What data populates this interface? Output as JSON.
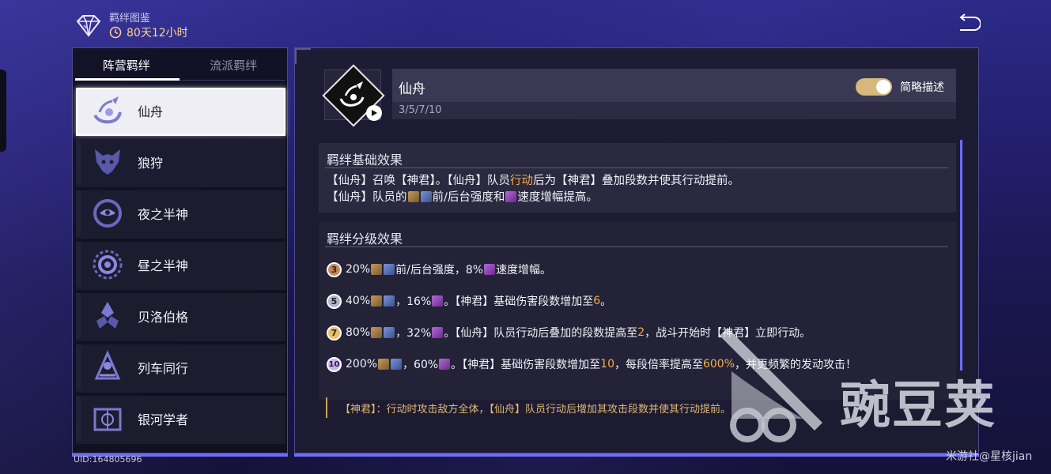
{
  "header": {
    "title": "羁绊图鉴",
    "timer": "80天12小时"
  },
  "tabs": [
    {
      "label": "阵营羁绊",
      "active": true
    },
    {
      "label": "流派羁绊",
      "active": false
    }
  ],
  "factions": [
    {
      "name": "仙舟",
      "icon": "xianzhou-icon",
      "selected": true
    },
    {
      "name": "狼狩",
      "icon": "wolf-icon",
      "selected": false
    },
    {
      "name": "夜之半神",
      "icon": "moon-icon",
      "selected": false
    },
    {
      "name": "昼之半神",
      "icon": "sun-icon",
      "selected": false
    },
    {
      "name": "贝洛伯格",
      "icon": "belobog-icon",
      "selected": false
    },
    {
      "name": "列车同行",
      "icon": "train-icon",
      "selected": false
    },
    {
      "name": "银河学者",
      "icon": "scholar-icon",
      "selected": false
    }
  ],
  "detail": {
    "name": "仙舟",
    "tiers": "3/5/7/10",
    "toggle_label": "简略描述",
    "toggle_on": true,
    "basic_title": "羁绊基础效果",
    "basic_line1": {
      "a": "【仙舟】召唤【神君】。【仙舟】队员",
      "hl": "行动",
      "b": "后为【神君】叠加段数并使其行动提前。"
    },
    "basic_line2": {
      "a": "【仙舟】队员的",
      "b": "前/后台强度和",
      "c": "速度增幅提高。"
    },
    "tier_title": "羁绊分级效果",
    "tier3": {
      "badge": "3",
      "a": "20%",
      "b": "前/后台强度，8%",
      "c": "速度增幅。"
    },
    "tier5": {
      "badge": "5",
      "a": "40%",
      "b": "，16%",
      "c": "。【神君】基础伤害段数增加至",
      "hl": "6",
      "d": "。"
    },
    "tier7": {
      "badge": "7",
      "a": "80%",
      "b": "，32%",
      "c": "。【仙舟】队员行动后叠加的段数提高至",
      "hl": "2",
      "d": "，战斗开始时【神君】立即行动。"
    },
    "tier10": {
      "badge": "10",
      "a": "200%",
      "b": "，60%",
      "c": "。【神君】基础伤害段数增加至",
      "hl1": "10",
      "d": "，每段倍率提高至",
      "hl2": "600%",
      "e": "，并更频繁的发动攻击！"
    },
    "note": "【神君】：行动时攻击敌方全体，【仙舟】队员行动后增加其攻击段数并使其行动提前。"
  },
  "uid": "UID:164805696",
  "watermark": {
    "logo_text": "豌豆荚",
    "credit": "米游社@星核jian"
  },
  "colors": {
    "accent": "#6f6cff",
    "highlight": "#f3ae46",
    "toggle": "#d6b77c"
  }
}
